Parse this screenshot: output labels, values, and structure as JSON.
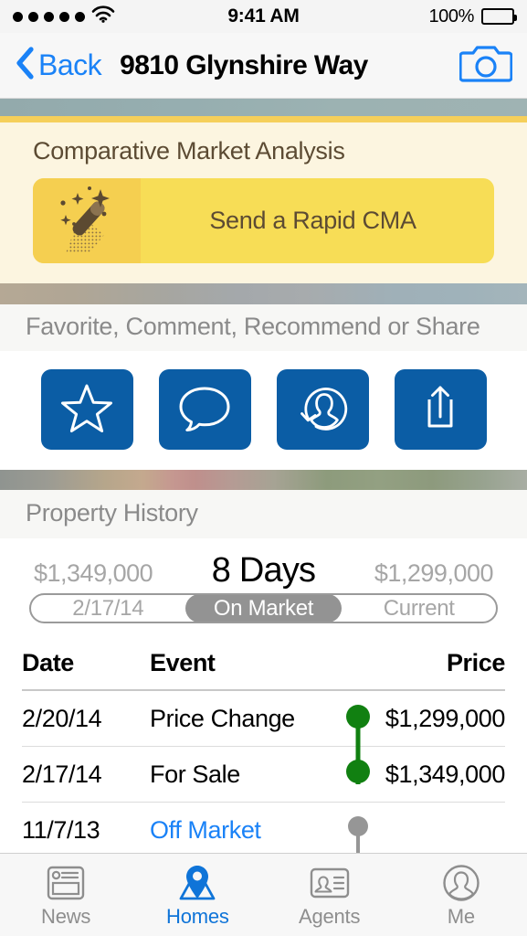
{
  "status_bar": {
    "signal_dots": 5,
    "wifi_icon": "wifi-icon",
    "time": "9:41 AM",
    "battery_percent": "100%",
    "battery_level": 100
  },
  "nav_bar": {
    "back_label": "Back",
    "back_icon": "chevron-left-icon",
    "title": "9810 Glynshire Way",
    "camera_icon": "camera-icon"
  },
  "cma": {
    "title": "Comparative Market Analysis",
    "button_label": "Send a Rapid CMA",
    "button_icon": "magic-wand-icon",
    "background_color": "#fcf5e0",
    "button_color": "#f7dd56",
    "icon_pane_color": "#f5cf50",
    "text_color": "#5c4b33"
  },
  "social": {
    "header": "Favorite, Comment, Recommend or Share",
    "button_color": "#0b5da5",
    "actions": [
      {
        "name": "favorite",
        "icon": "star-icon"
      },
      {
        "name": "comment",
        "icon": "speech-bubble-icon"
      },
      {
        "name": "recommend",
        "icon": "person-refresh-icon"
      },
      {
        "name": "share",
        "icon": "share-upload-icon"
      }
    ]
  },
  "property_history": {
    "header": "Property History",
    "summary": {
      "left_price": "$1,349,000",
      "days": "8 Days",
      "right_price": "$1,299,000",
      "left_segment": "2/17/14",
      "middle_segment": "On Market",
      "right_segment": "Current"
    },
    "columns": {
      "date": "Date",
      "event": "Event",
      "price": "Price"
    },
    "rows": [
      {
        "date": "2/20/14",
        "event": "Price Change",
        "price": "$1,299,000",
        "marker_color": "#118011",
        "is_link": false
      },
      {
        "date": "2/17/14",
        "event": "For Sale",
        "price": "$1,349,000",
        "marker_color": "#118011",
        "is_link": false
      },
      {
        "date": "11/7/13",
        "event": "Off Market",
        "price": "",
        "marker_color": "#969696",
        "is_link": true
      }
    ]
  },
  "tab_bar": {
    "active_color": "#0f74d8",
    "inactive_color": "#8e8e8e",
    "items": [
      {
        "label": "News",
        "icon": "news-article-icon",
        "active": false
      },
      {
        "label": "Homes",
        "icon": "map-pin-icon",
        "active": true
      },
      {
        "label": "Agents",
        "icon": "contact-card-icon",
        "active": false
      },
      {
        "label": "Me",
        "icon": "person-avatar-icon",
        "active": false
      }
    ]
  }
}
